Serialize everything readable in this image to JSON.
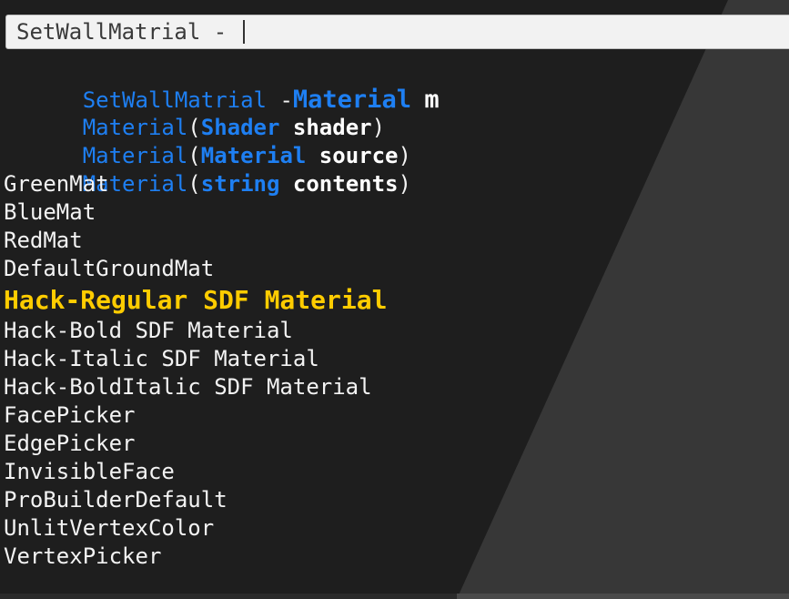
{
  "search": {
    "value": "SetWallMatrial - "
  },
  "signature": {
    "name": "SetWallMatrial",
    "dash": " -",
    "param_type": "Material",
    "param_name": "m"
  },
  "constructors": [
    {
      "name": "Material",
      "open": "(",
      "type": "Shader",
      "arg": "shader",
      "close": ")"
    },
    {
      "name": "Material",
      "open": "(",
      "type": "Material",
      "arg": "source",
      "close": ")"
    },
    {
      "name": "Material",
      "open": "(",
      "type": "string",
      "arg": "contents",
      "close": ")"
    }
  ],
  "items_before": [
    "GreenMat",
    "BlueMat",
    "RedMat",
    "DefaultGroundMat"
  ],
  "selected_item": "Hack-Regular SDF Material",
  "items_after": [
    "Hack-Bold SDF Material",
    "Hack-Italic SDF Material",
    "Hack-BoldItalic SDF Material",
    "FacePicker",
    "EdgePicker",
    "InvisibleFace",
    "ProBuilderDefault",
    "UnlitVertexColor",
    "VertexPicker"
  ],
  "colors": {
    "background": "#1e1e1e",
    "keyword": "#1e7ff2",
    "highlight": "#ffcc00",
    "text": "#f3f3f3"
  }
}
